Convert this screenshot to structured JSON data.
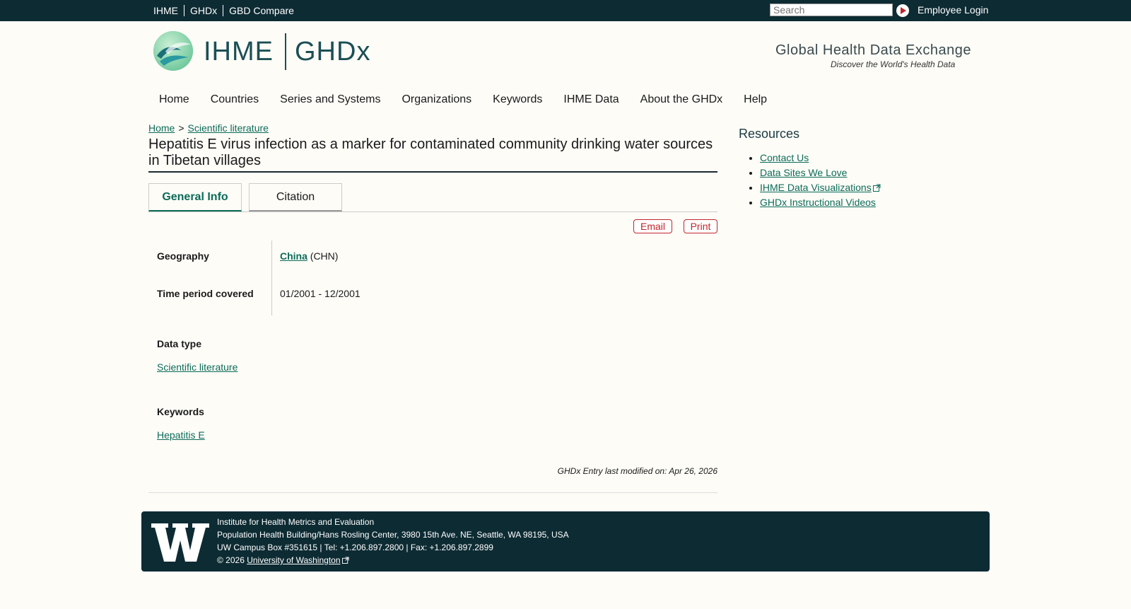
{
  "topbar": {
    "links": [
      "IHME",
      "GHDx",
      "GBD Compare"
    ],
    "search_placeholder": "Search",
    "employee_login": "Employee Login"
  },
  "header": {
    "logo_ihme": "IHME",
    "logo_ghdx": "GHDx",
    "tagline": "Global Health Data Exchange",
    "subtagline": "Discover the World's Health Data"
  },
  "nav": {
    "items": [
      "Home",
      "Countries",
      "Series and Systems",
      "Organizations",
      "Keywords",
      "IHME Data",
      "About the GHDx",
      "Help"
    ]
  },
  "breadcrumb": {
    "home": "Home",
    "separator": ">",
    "current": "Scientific literature"
  },
  "page": {
    "title": "Hepatitis E virus infection as a marker for contaminated community drinking water sources in Tibetan villages"
  },
  "tabs": [
    "General Info",
    "Citation"
  ],
  "actions": {
    "email": "Email",
    "print": "Print"
  },
  "info": {
    "geography_label": "Geography",
    "geography_link": "China",
    "geography_code": "(CHN)",
    "time_label": "Time period covered",
    "time_value": "01/2001 - 12/2001",
    "datatype_label": "Data type",
    "datatype_value": "Scientific literature",
    "keywords_label": "Keywords",
    "keywords_value": "Hepatitis E"
  },
  "modified": "GHDx Entry last modified on: Apr 26, 2026",
  "resources": {
    "title": "Resources",
    "items": [
      "Contact Us",
      "Data Sites We Love",
      "IHME Data Visualizations",
      "GHDx Instructional Videos"
    ]
  },
  "footer": {
    "line1": "Institute for Health Metrics and Evaluation",
    "line2": "Population Health Building/Hans Rosling Center, 3980 15th Ave. NE, Seattle, WA 98195, USA",
    "line3": "UW Campus Box #351615 | Tel: +1.206.897.2800 | Fax: +1.206.897.2899",
    "copyright": "© 2026",
    "uw_link": "University of Washington"
  },
  "colors": {
    "topbar": "#0d2b33",
    "link": "#0c6b58",
    "accent_red": "#c0262d",
    "background": "#fdfcf7"
  }
}
